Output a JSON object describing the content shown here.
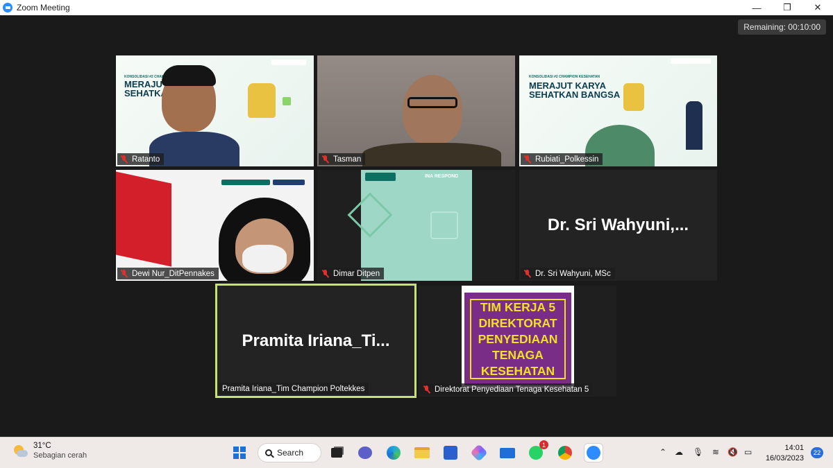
{
  "window": {
    "title": "Zoom Meeting",
    "minimize": "—",
    "maximize": "❐",
    "close": "✕"
  },
  "meeting": {
    "remaining": "Remaining: 00:10:00"
  },
  "participants": [
    {
      "name": "Ratanto",
      "muted": true
    },
    {
      "name": "Tasman",
      "muted": true
    },
    {
      "name": "Rubiati_Polkessin",
      "muted": true
    },
    {
      "name": "Dewi Nur_DitPennakes",
      "muted": true
    },
    {
      "name": "Dimar Ditpen",
      "muted": true
    },
    {
      "name": "Dr. Sri Wahyuni, MSc",
      "muted": true,
      "display_text": "Dr. Sri Wahyuni,..."
    },
    {
      "name": "Pramita Iriana_Tim Champion Poltekkes",
      "muted": false,
      "active_speaker": true,
      "display_text": "Pramita  Iriana_Ti..."
    },
    {
      "name": "Direktorat Penyediaan Tenaga Kesehatan 5",
      "muted": true,
      "sign_text": "TIM KERJA 5\nDIREKTORAT\nPENYEDIAAN\nTENAGA\nKESEHATAN"
    }
  ],
  "banners": {
    "champion_1": "MERAJUT K\nSEHATKAN",
    "champion_2": "MERAJUT KARYA\nSEHATKAN BANGSA",
    "small_header": "KONSOLIDASI #2 CHAMPION KESEHATAN",
    "berakhlak": "BerAKHLAK",
    "ina_respond": "INA RESPOND"
  },
  "taskbar": {
    "weather_temp": "31°C",
    "weather_desc": "Sebagian cerah",
    "search_label": "Search",
    "whatsapp_badge": "1",
    "time": "14:01",
    "date": "16/03/2023",
    "notifications": "22"
  },
  "colors": {
    "active_speaker_border": "#c8e36b",
    "mute_red": "#e0302b",
    "sign_purple": "#7a2d86",
    "sign_yellow": "#f2e027"
  }
}
